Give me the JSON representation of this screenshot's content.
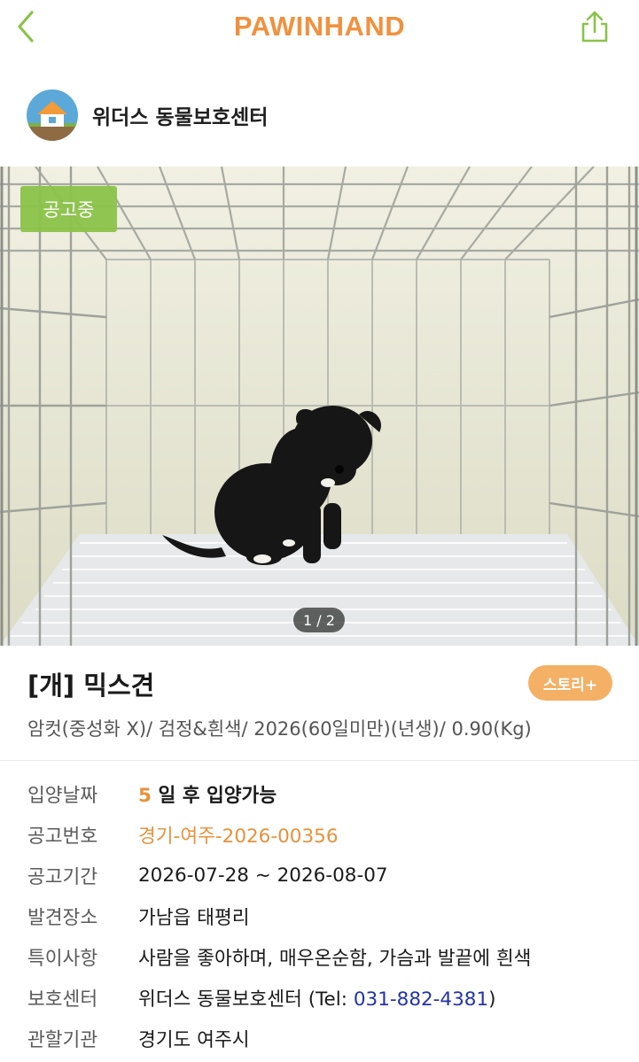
{
  "header": {
    "logo": "PAWINHAND",
    "back_icon": "chevron-left-icon",
    "share_icon": "share-icon"
  },
  "shelter": {
    "name": "위더스 동물보호센터",
    "avatar_icon": "house-icon"
  },
  "photo": {
    "status_badge": "공고중",
    "pager": "1 / 2"
  },
  "animal": {
    "title": "[개] 믹스견",
    "story_button": "스토리+",
    "summary": "암컷(중성화 X)/ 검정&흰색/ 2026(60일미만)(년생)/ 0.90(Kg)"
  },
  "details": {
    "adoption_date_label": "입양날짜",
    "adoption_days": "5",
    "adoption_suffix": " 일 후 입양가능",
    "notice_number_label": "공고번호",
    "notice_number": "경기-여주-2026-00356",
    "notice_period_label": "공고기간",
    "notice_period": "2026-07-28 ~ 2026-08-07",
    "found_place_label": "발견장소",
    "found_place": "가남읍 태평리",
    "features_label": "특이사항",
    "features": "사람을 좋아하며, 매우온순함, 가슴과 발끝에 흰색",
    "shelter_label": "보호센터",
    "shelter_prefix": "위더스 동물보호센터 (Tel: ",
    "shelter_tel": "031-882-4381",
    "shelter_suffix": ")",
    "authority_label": "관할기관",
    "authority": "경기도 여주시"
  },
  "colors": {
    "brand": "#F0913F",
    "badge_green": "#8BC34A",
    "story": "#F4B064",
    "link": "#2233aa"
  }
}
